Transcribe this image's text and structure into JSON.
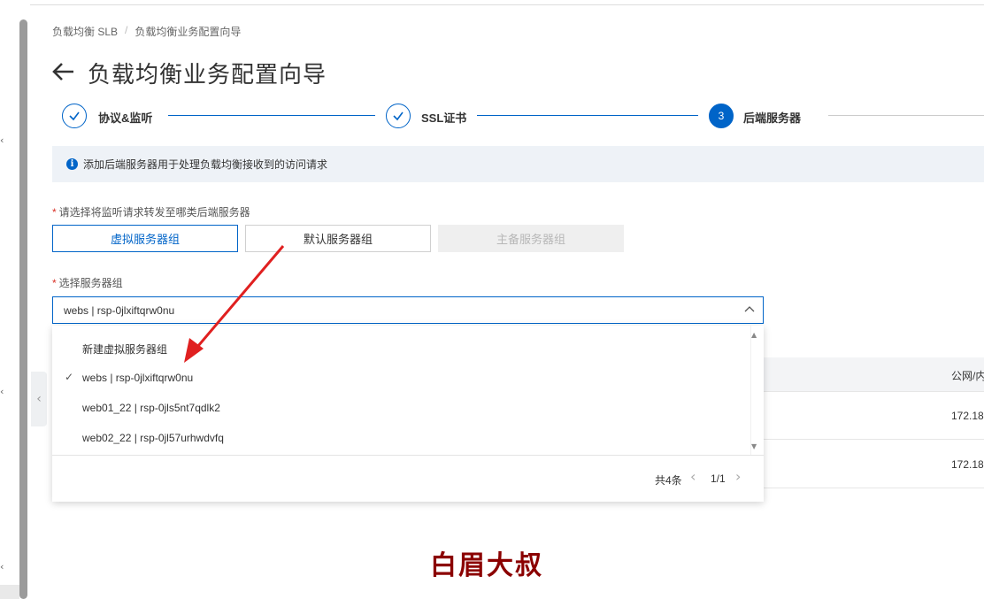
{
  "breadcrumb": {
    "item1": "负载均衡 SLB",
    "separator": "/",
    "item2": "负载均衡业务配置向导"
  },
  "page": {
    "title": "负载均衡业务配置向导",
    "back_icon": "arrow-left-icon"
  },
  "steps": [
    {
      "label": "协议&监听",
      "status": "done"
    },
    {
      "label": "SSL证书",
      "status": "done"
    },
    {
      "number": "3",
      "label": "后端服务器",
      "status": "active"
    }
  ],
  "info": {
    "text": "添加后端服务器用于处理负载均衡接收到的访问请求",
    "icon": "info-icon"
  },
  "server_type": {
    "required_mark": "*",
    "label": "请选择将监听请求转发至哪类后端服务器",
    "options": [
      "虚拟服务器组",
      "默认服务器组",
      "主备服务器组"
    ],
    "selected": "虚拟服务器组",
    "disabled": "主备服务器组"
  },
  "server_group": {
    "required_mark": "*",
    "label": "选择服务器组",
    "value": "webs | rsp-0jlxiftqrw0nu",
    "options": [
      {
        "label": "新建虚拟服务器组",
        "checked": false
      },
      {
        "label": "webs | rsp-0jlxiftqrw0nu",
        "checked": true
      },
      {
        "label": "web01_22 | rsp-0jls5nt7qdlk2",
        "checked": false
      },
      {
        "label": "web02_22 | rsp-0jl57urhwdvfq",
        "checked": false
      }
    ],
    "check_glyph": "✓",
    "pagination": {
      "total": "共4条",
      "page": "1/1"
    }
  },
  "background_table": {
    "column_header": "公网/内",
    "rows": [
      "172.18.",
      "172.18."
    ]
  },
  "watermark": "白眉大叔",
  "colors": {
    "primary": "#0064c8",
    "required": "#d93026",
    "arrow": "#e02020",
    "watermark": "#8b0000"
  }
}
